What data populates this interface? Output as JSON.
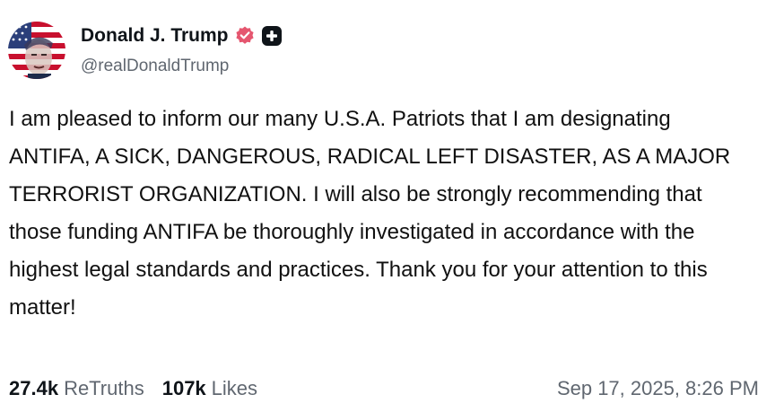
{
  "author": {
    "display_name": "Donald J. Trump",
    "handle": "@realDonaldTrump",
    "verified_icon": "verified-badge-icon",
    "badge_icon": "plus-icon",
    "badge_color": "#e5566f"
  },
  "post": {
    "text": "I am pleased to inform our many U.S.A. Patriots that I am designating ANTIFA, A SICK, DANGEROUS, RADICAL LEFT DISASTER, AS A MAJOR TERRORIST ORGANIZATION. I will also be strongly recommending that those funding ANTIFA be thoroughly investigated in accordance with the highest legal standards and practices. Thank you for your attention to this matter!"
  },
  "stats": {
    "retruths_count": "27.4k",
    "retruths_label": "ReTruths",
    "likes_count": "107k",
    "likes_label": "Likes"
  },
  "timestamp": "Sep 17, 2025, 8:26 PM"
}
